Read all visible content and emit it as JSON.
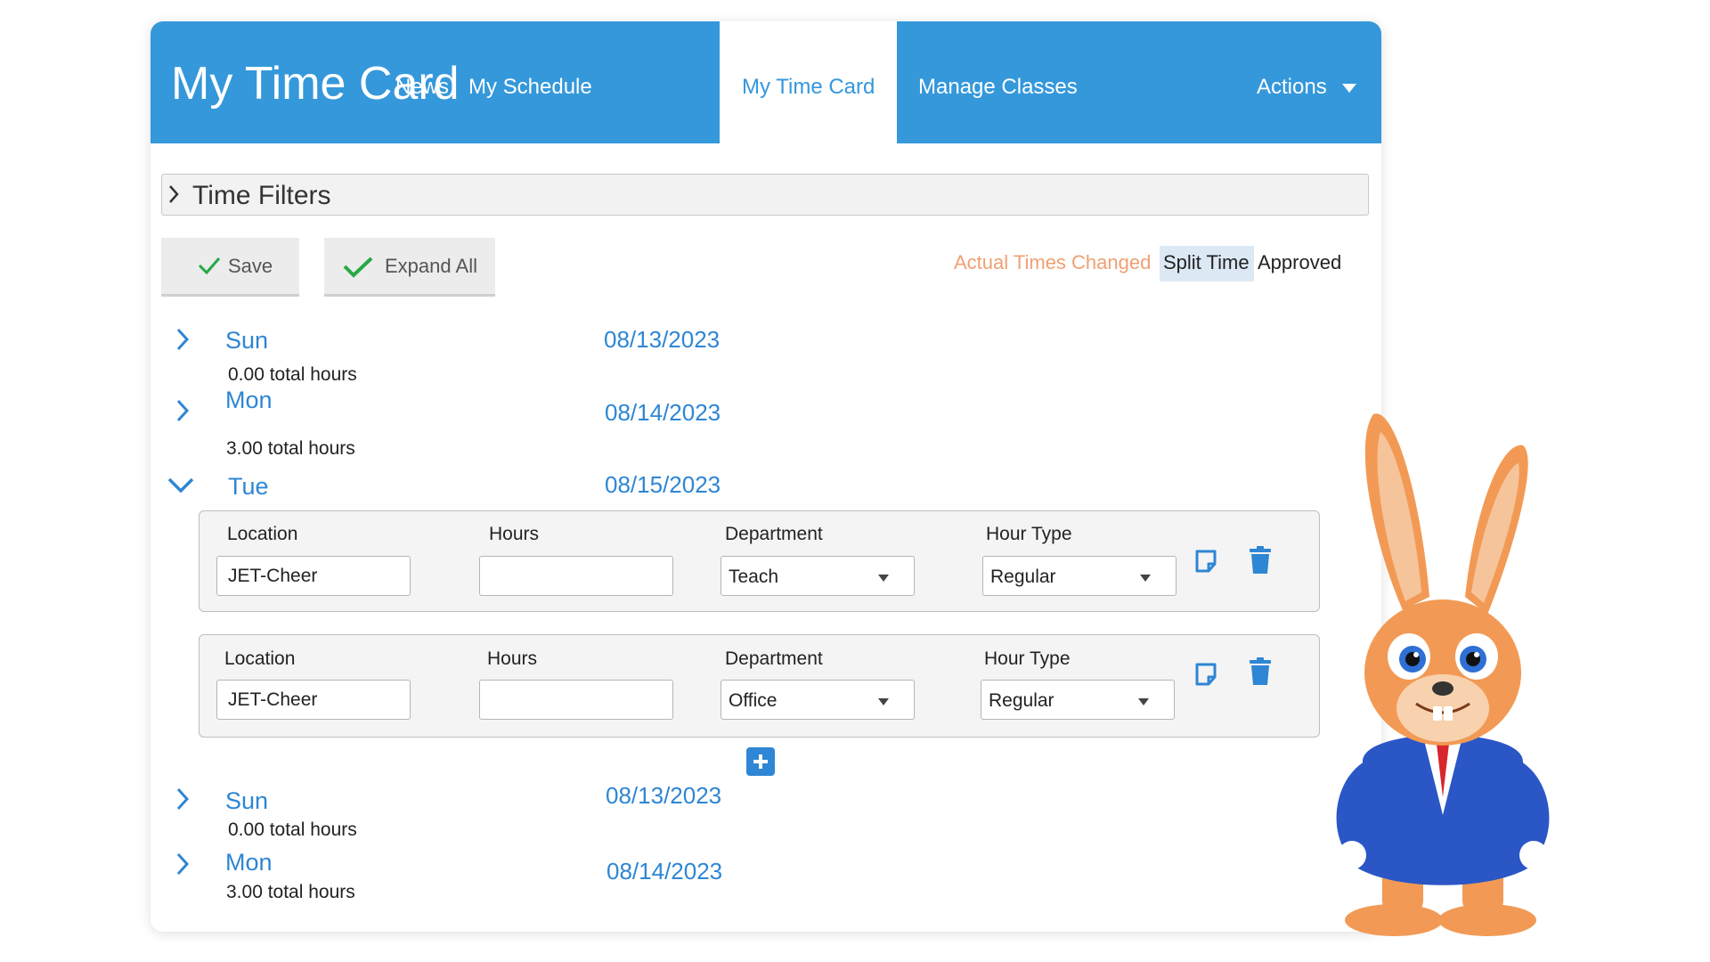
{
  "header": {
    "title": "My Time Card",
    "nav": [
      "News",
      "My Schedule",
      "My Time Card",
      "Manage Classes"
    ],
    "actions_label": "Actions"
  },
  "filters": {
    "label": "Time Filters"
  },
  "toolbar": {
    "save_label": "Save",
    "expand_label": "Expand All"
  },
  "legend": {
    "changed": "Actual Times Changed",
    "split": "Split Time",
    "approved": "Approved"
  },
  "days": [
    {
      "name": "Sun",
      "date": "08/13/2023",
      "total": "0.00 total hours"
    },
    {
      "name": "Mon",
      "date": "08/14/2023",
      "total": "3.00 total hours"
    },
    {
      "name": "Tue",
      "date": "08/15/2023"
    },
    {
      "name": "Sun",
      "date": "08/13/2023",
      "total": "0.00 total hours"
    },
    {
      "name": "Mon",
      "date": "08/14/2023",
      "total": "3.00 total hours"
    }
  ],
  "entry_labels": {
    "location": "Location",
    "hours": "Hours",
    "department": "Department",
    "hour_type": "Hour  Type"
  },
  "entries": [
    {
      "location": "JET-Cheer",
      "hours": "",
      "department": "Teach",
      "hour_type": "Regular"
    },
    {
      "location": "JET-Cheer",
      "hours": "",
      "department": "Office",
      "hour_type": "Regular"
    }
  ],
  "colors": {
    "brand_blue": "#3498db",
    "link_blue": "#2e86d4",
    "changed_orange": "#f0a073",
    "split_bg": "#dce9f5"
  },
  "icons": [
    "chevron-right-icon",
    "chevron-down-icon",
    "check-icon",
    "note-icon",
    "trash-icon",
    "plus-icon",
    "caret-down-icon",
    "bunny-mascot"
  ]
}
